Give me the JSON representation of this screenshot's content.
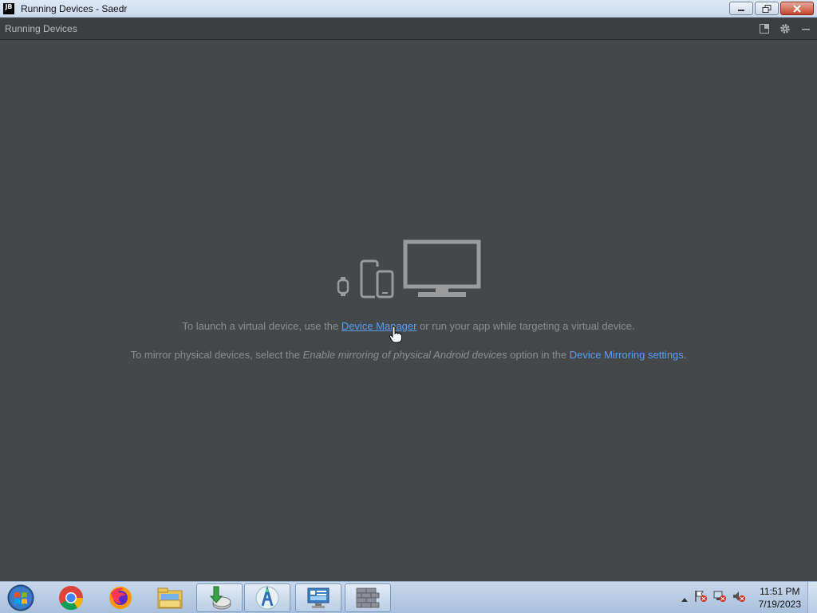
{
  "window": {
    "badge": "JB",
    "title": "Running Devices - Saedr"
  },
  "tool_window": {
    "title": "Running Devices"
  },
  "empty_state": {
    "line1_pre": "To launch a virtual device, use the ",
    "line1_link": "Device Manager",
    "line1_post": " or run your app while targeting a virtual device.",
    "line2_pre": "To mirror physical devices, select the ",
    "line2_em": "Enable mirroring of physical Android devices",
    "line2_mid": " option in the ",
    "line2_link": "Device Mirroring settings",
    "line2_post": "."
  },
  "taskbar": {
    "items": [
      "start-orb",
      "chrome-icon",
      "firefox-icon",
      "file-explorer-icon",
      "installer-icon",
      "android-studio-icon",
      "control-panel-icon",
      "firewall-icon"
    ]
  },
  "clock": {
    "time": "11:51 PM",
    "date": "7/19/2023"
  },
  "colors": {
    "background": "#45484a",
    "text": "#8c8c8c",
    "link": "#589df6",
    "device_icons": "#9b9b9b"
  }
}
